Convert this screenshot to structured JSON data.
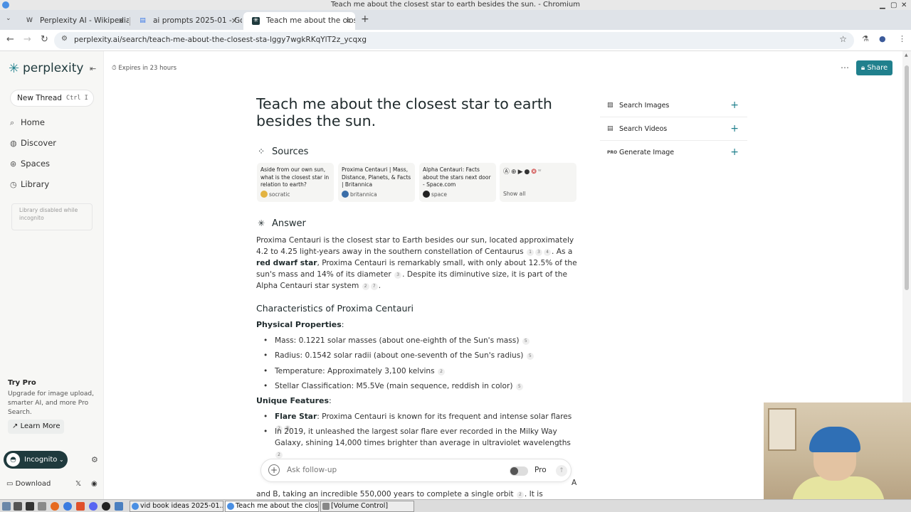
{
  "window": {
    "title": "Teach me about the closest star to earth besides the sun. - Chromium"
  },
  "tabs": [
    {
      "label": "Perplexity AI - Wikipedia",
      "favicon": "W"
    },
    {
      "label": "ai prompts 2025-01 - Goo",
      "favicon": "▤"
    },
    {
      "label": "Teach me about the close",
      "favicon": "✳"
    }
  ],
  "address": {
    "url": "perplexity.ai/search/teach-me-about-the-closest-sta-lggy7wgkRKqYlT2z_ycqxg"
  },
  "sidebar": {
    "brand": "perplexity",
    "new_thread": "New Thread",
    "shortcut": "Ctrl  I",
    "items": [
      {
        "label": "Home",
        "icon": "search-icon"
      },
      {
        "label": "Discover",
        "icon": "globe-icon"
      },
      {
        "label": "Spaces",
        "icon": "spaces-icon"
      },
      {
        "label": "Library",
        "icon": "library-icon"
      }
    ],
    "library_note": "Library disabled while incognito",
    "try_pro": "Try Pro",
    "pro_text": "Upgrade for image upload, smarter AI, and more Pro Search.",
    "learn_more": "Learn More",
    "incognito": "Incognito",
    "download": "Download"
  },
  "header": {
    "expires": "Expires in 23 hours",
    "share": "Share"
  },
  "question": "Teach me about the closest star to earth besides the sun.",
  "sources": {
    "heading": "Sources",
    "cards": [
      {
        "title": "Aside from our own sun, what is the closest star in relation to earth?",
        "site": "socratic",
        "color": "#e3b341"
      },
      {
        "title": "Proxima Centauri | Mass, Distance, Planets, & Facts | Britannica",
        "site": "britannica",
        "color": "#3b6ea8"
      },
      {
        "title": "Alpha Centauri: Facts about the stars next door - Space.com",
        "site": "space",
        "color": "#222222"
      }
    ],
    "show_all": "Show all"
  },
  "answer": {
    "heading": "Answer",
    "p1_a": "Proxima Centauri is the closest star to Earth besides our sun, located approximately 4.2 to 4.25 light-years away in the southern constellation of Centaurus",
    "p1_b": ". As a ",
    "p1_bold": "red dwarf star",
    "p1_c": ", Proxima Centauri is remarkably small, with only about 12.5% of the sun's mass and 14% of its diameter",
    "p1_d": ". Despite its diminutive size, it is part of the Alpha Centauri star system",
    "p1_e": ".",
    "cites1": [
      "1",
      "3",
      "4"
    ],
    "cites2": [
      "3"
    ],
    "cites3": [
      "2",
      "7"
    ],
    "characteristics": "Characteristics of Proxima Centauri",
    "physical": "Physical Properties",
    "physical_items": [
      {
        "text": "Mass: 0.1221 solar masses (about one-eighth of the Sun's mass)",
        "cite": "5"
      },
      {
        "text": "Radius: 0.1542 solar radii (about one-seventh of the Sun's radius)",
        "cite": "5"
      },
      {
        "text": "Temperature: Approximately 3,100 kelvins",
        "cite": "2"
      },
      {
        "text": "Stellar Classification: M5.5Ve (main sequence, reddish in color)",
        "cite": "5"
      }
    ],
    "unique": "Unique Features",
    "flare_bold": "Flare Star",
    "flare_text": ": Proxima Centauri is known for its frequent and intense solar flares",
    "flare_cites": [
      "2",
      "8"
    ],
    "flare_2019": "In 2019, it unleashed the largest solar flare ever recorded in the Milky Way Galaxy, shining 14,000 times brighter than average in ultraviolet wavelengths",
    "flare_2019_cite": "2",
    "bottom_a": "A",
    "bottom_text": "and B, taking an incredible 550,000 years to complete a single orbit",
    "bottom_cite": "2",
    "bottom_tail": ". It is currently the"
  },
  "followup": {
    "placeholder": "Ask follow-up",
    "pro": "Pro"
  },
  "right_panel": [
    {
      "label": "Search Images",
      "icon": "image-icon"
    },
    {
      "label": "Search Videos",
      "icon": "video-icon"
    },
    {
      "label": "Generate Image",
      "icon": "pro-icon"
    }
  ],
  "taskbar": {
    "tasks": [
      "vid book ideas 2025-01...",
      "Teach me about the clos...",
      "[Volume Control]"
    ]
  },
  "colors": {
    "accent": "#20808d",
    "brand_dark": "#1f3a3d"
  }
}
